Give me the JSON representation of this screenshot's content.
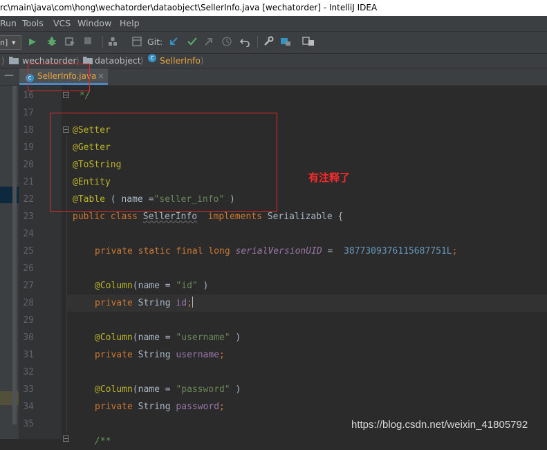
{
  "window": {
    "title": "rc\\main\\java\\com\\hong\\wechatorder\\dataobject\\SellerInfo.java [wechatorder] - IntelliJ IDEA"
  },
  "menu": [
    "Run",
    "Tools",
    "VCS",
    "Window",
    "Help"
  ],
  "toolbar": {
    "run_config": "n]",
    "git_label": "Git:"
  },
  "breadcrumb": {
    "module": "wechatorder",
    "package": "dataobject",
    "class": "SellerInfo"
  },
  "tab": {
    "label": "SellerInfo.java",
    "close": "×"
  },
  "editor": {
    "line_numbers": [
      "16",
      "17",
      "18",
      "19",
      "20",
      "21",
      "22",
      "23",
      "24",
      "25",
      "26",
      "27",
      "28",
      "29",
      "30",
      "31",
      "32",
      "33",
      "34",
      "35"
    ],
    "comment_end": "*/",
    "annotations": [
      "@Setter",
      "@Getter",
      "@ToString",
      "@Entity"
    ],
    "table": {
      "ann": "@Table",
      "open": " ( ",
      "param": "name =",
      "value": "\"seller_info\"",
      "close": " )"
    },
    "class_decl": {
      "kw1": "public class ",
      "name": "SellerInfo",
      "kw2": "  implements",
      "rest": " Serializable {"
    },
    "serial": {
      "mods": "private static final long ",
      "name": "serialVersionUID",
      "eq": " =  ",
      "value": "3877309376115687751L",
      "semi": ";"
    },
    "fields": [
      {
        "col_ann": "@Column",
        "col_open": "(name = ",
        "col_value": "\"id\"",
        "col_close": " )",
        "decl_kw": "private ",
        "type": "String ",
        "name": "id",
        "semi": ";"
      },
      {
        "col_ann": "@Column",
        "col_open": "(name = ",
        "col_value": "\"username\"",
        "col_close": " )",
        "decl_kw": "private ",
        "type": "String ",
        "name": "username",
        "semi": ";"
      },
      {
        "col_ann": "@Column",
        "col_open": "(name = ",
        "col_value": "\"password\"",
        "col_close": " )",
        "decl_kw": "private ",
        "type": "String ",
        "name": "password",
        "semi": ";"
      }
    ],
    "last_line_partial": "/**"
  },
  "overlay": {
    "note": "有注释了",
    "watermark": "https://blog.csdn.net/weixin_41805792",
    "highlight_color": "#e52b2b"
  },
  "colors": {
    "keyword": "#cc7832",
    "annotation": "#bbb529",
    "string": "#6a8759",
    "number": "#6897bb",
    "field": "#9876aa"
  }
}
